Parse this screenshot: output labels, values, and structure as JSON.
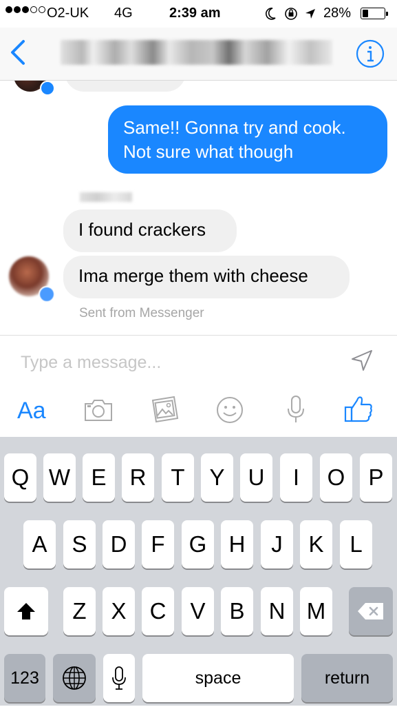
{
  "status_bar": {
    "carrier": "O2-UK",
    "network": "4G",
    "time": "2:39 am",
    "battery_percent": "28%",
    "battery_level": 0.28,
    "signal_bars_filled": 3,
    "signal_bars_total": 5
  },
  "nav": {
    "back_icon": "chevron-left-icon",
    "info_icon": "info-circle-icon",
    "accent_color": "#1a87ff"
  },
  "chat": {
    "messages": [
      {
        "direction": "outgoing",
        "text": "Same!! Gonna try and cook. Not sure what though"
      },
      {
        "direction": "incoming",
        "text": "I found crackers"
      },
      {
        "direction": "incoming",
        "text": "Ima merge them with cheese"
      }
    ],
    "sent_via": "Sent from Messenger"
  },
  "composer": {
    "placeholder": "Type a message...",
    "text_tool_label": "Aa",
    "tools": [
      "camera-icon",
      "gallery-icon",
      "emoji-icon",
      "microphone-icon",
      "like-icon"
    ]
  },
  "keyboard": {
    "row1": [
      "Q",
      "W",
      "E",
      "R",
      "T",
      "Y",
      "U",
      "I",
      "O",
      "P"
    ],
    "row2": [
      "A",
      "S",
      "D",
      "F",
      "G",
      "H",
      "J",
      "K",
      "L"
    ],
    "row3": [
      "Z",
      "X",
      "C",
      "V",
      "B",
      "N",
      "M"
    ],
    "numbers_label": "123",
    "space_label": "space",
    "return_label": "return"
  }
}
